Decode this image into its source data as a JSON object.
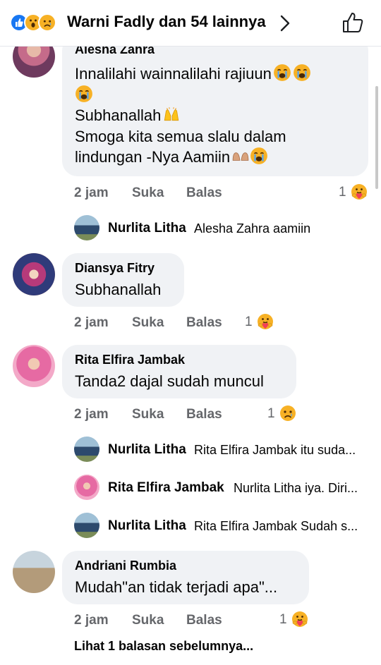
{
  "header": {
    "reactions": [
      "like-icon",
      "wow-icon",
      "sad-icon"
    ],
    "summary": "Warni Fadly dan 54 lainnya"
  },
  "comments": [
    {
      "author": "Alesha Zahra",
      "lines": [
        "Innalilahi wainnalilahi rajiuun",
        "",
        "Subhanallah",
        "Smoga kita semua slalu dalam",
        "lindungan -Nya Aamiin"
      ],
      "time": "2 jam",
      "like": "Suka",
      "reply": "Balas",
      "reaction_count": "1",
      "reaction_icon": "care-icon"
    },
    {
      "author": "Diansya Fitry",
      "lines": [
        "Subhanallah"
      ],
      "time": "2 jam",
      "like": "Suka",
      "reply": "Balas",
      "reaction_count": "1",
      "reaction_icon": "care-icon"
    },
    {
      "author": "Rita Elfira Jambak",
      "lines": [
        "Tanda2 dajal sudah muncul"
      ],
      "time": "2 jam",
      "like": "Suka",
      "reply": "Balas",
      "reaction_count": "1",
      "reaction_icon": "sad-icon"
    },
    {
      "author": "Andriani Rumbia",
      "lines": [
        "Mudah\"an tidak terjadi apa\"..."
      ],
      "time": "2 jam",
      "like": "Suka",
      "reply": "Balas",
      "reaction_count": "1",
      "reaction_icon": "care-icon"
    }
  ],
  "replies": [
    {
      "name": "Nurlita Litha",
      "text": "Alesha Zahra aamiin"
    },
    {
      "name": "Nurlita Litha",
      "text": "Rita Elfira Jambak itu suda..."
    },
    {
      "name": "Rita Elfira Jambak",
      "text": "Nurlita Litha iya. Diri..."
    },
    {
      "name": "Nurlita Litha",
      "text": "Rita Elfira Jambak Sudah s..."
    }
  ],
  "more_replies": "Lihat 1 balasan sebelumnya...",
  "colors": {
    "like_blue": "#1877f2",
    "reaction_yellow": "#f7b125",
    "meta_grey": "#65676b",
    "bubble_bg": "#f0f2f5"
  }
}
